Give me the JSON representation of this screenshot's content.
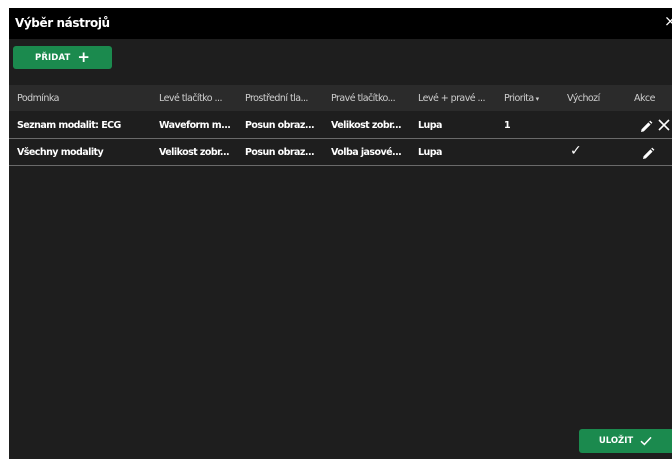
{
  "dialog": {
    "title": "Výběr nástrojů",
    "close_icon": "close-icon"
  },
  "toolbar": {
    "add_label": "PŘIDAT",
    "add_icon": "plus-icon"
  },
  "table": {
    "columns": [
      "Podmínka",
      "Levé tlačítko ...",
      "Prostřední tla...",
      "Pravé tlačítko...",
      "Levé + pravé ...",
      "Priorita",
      "Výchozí",
      "Akce"
    ],
    "sort_indicator": "▾",
    "rows": [
      {
        "condition": "Seznam modalit: ECG",
        "left": "Waveform m...",
        "middle": "Posun obraz...",
        "right": "Velikost zobr...",
        "left_right": "Lupa",
        "priority": "1",
        "default": false,
        "actions": [
          "pencil-icon",
          "delete-icon"
        ]
      },
      {
        "condition": "Všechny modality",
        "left": "Velikost zobr...",
        "middle": "Posun obraz...",
        "right": "Volba jasové...",
        "left_right": "Lupa",
        "priority": "",
        "default": true,
        "actions": [
          "pencil-icon"
        ]
      }
    ]
  },
  "footer": {
    "save_label": "ULOŽIT",
    "save_icon": "checkmark-icon"
  },
  "colors": {
    "accent": "#1b8a4e",
    "background": "#1e1e1e",
    "header": "#2b2b2b",
    "titlebar": "#000000"
  }
}
